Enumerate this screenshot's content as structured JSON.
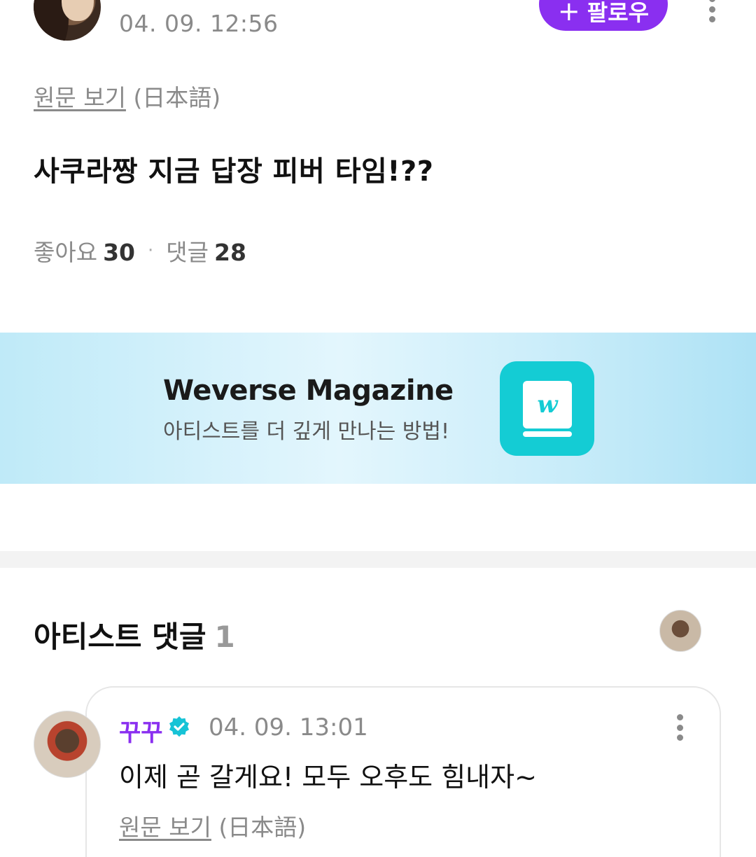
{
  "post": {
    "time": "04. 09. 12:56",
    "follow_label": "팔로우",
    "follow_plus": "+",
    "translate_link": "원문 보기",
    "translate_lang": "(日本語)",
    "body": "사쿠라짱 지금 답장 피버 타임!??",
    "likes_label": "좋아요",
    "likes_count": "30",
    "separator": "·",
    "comments_label": "댓글",
    "comments_count": "28"
  },
  "banner": {
    "title": "Weverse Magazine",
    "subtitle": "아티스트를 더 깊게 만나는 방법!",
    "logo_glyph": "w",
    "logo_color": "#14ccd4",
    "background": "#d6f1fb"
  },
  "artist_comments": {
    "title": "아티스트 댓글",
    "count": "1"
  },
  "comment": {
    "author": "꾸꾸",
    "verified_icon": "verified-check-icon",
    "time": "04. 09. 13:01",
    "text": "이제 곧 갈게요! 모두 오후도 힘내자~",
    "translate_link": "원문 보기",
    "translate_lang": "(日本語)"
  },
  "colors": {
    "accent": "#8a2ff0",
    "muted_text": "#8a8a8a",
    "verified": "#17c3d6"
  }
}
